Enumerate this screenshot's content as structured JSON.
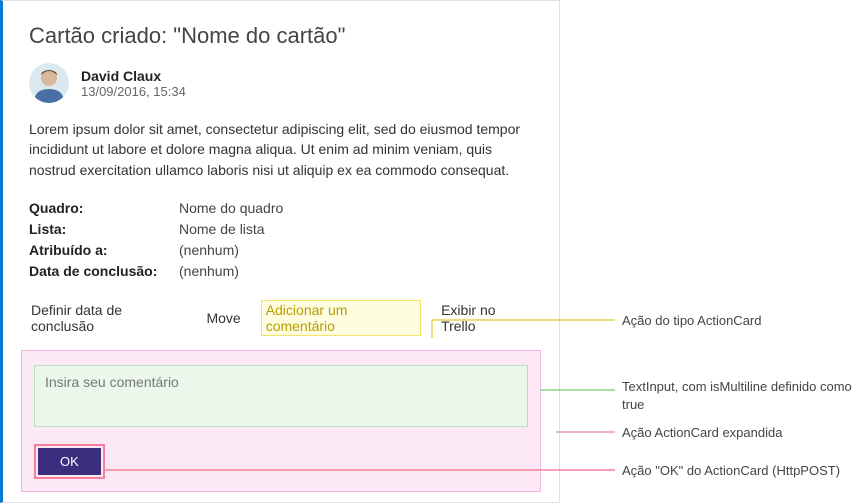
{
  "title": "Cartão criado: \"Nome do cartão\"",
  "author": {
    "name": "David Claux",
    "date": "13/09/2016, 15:34"
  },
  "body": "Lorem ipsum dolor sit amet, consectetur adipiscing elit, sed do eiusmod tempor incididunt ut labore et dolore magna aliqua. Ut enim ad minim veniam, quis nostrud exercitation ullamco laboris nisi ut aliquip ex ea commodo consequat.",
  "meta": [
    {
      "label": "Quadro:",
      "value": "Nome do quadro"
    },
    {
      "label": "Lista:",
      "value": "Nome de lista"
    },
    {
      "label": "Atribuído a:",
      "value": "(nenhum)"
    },
    {
      "label": "Data de conclusão:",
      "value": "(nenhum)"
    }
  ],
  "actions": {
    "setDueDate": "Definir data de conclusão",
    "move": "Move",
    "addComment": "Adicionar um comentário",
    "viewInTrello": "Exibir no Trello"
  },
  "comment": {
    "placeholder": "Insira seu comentário",
    "okLabel": "OK"
  },
  "callouts": {
    "actionCardType": "Ação do tipo ActionCard",
    "textInput": "TextInput, com isMultiline definido como true",
    "expanded": "Ação ActionCard expandida",
    "okAction": "Ação \"OK\" do ActionCard (HttpPOST)"
  },
  "colors": {
    "accent": "#0078d4",
    "highlightBg": "#fffde0",
    "highlightBorder": "#f6e36b",
    "panelBg": "#fde9f6",
    "panelBorder": "#f3b6de",
    "inputBg": "#eaf7ea",
    "inputBorder": "#b7e3b7",
    "okBg": "#3b2e7e",
    "okBorder": "#f77f9b",
    "connectorYellow": "#e6d34a",
    "connectorGreen": "#8cd28c",
    "connectorPink": "#e59ac2",
    "connectorRed": "#f77f9b"
  }
}
